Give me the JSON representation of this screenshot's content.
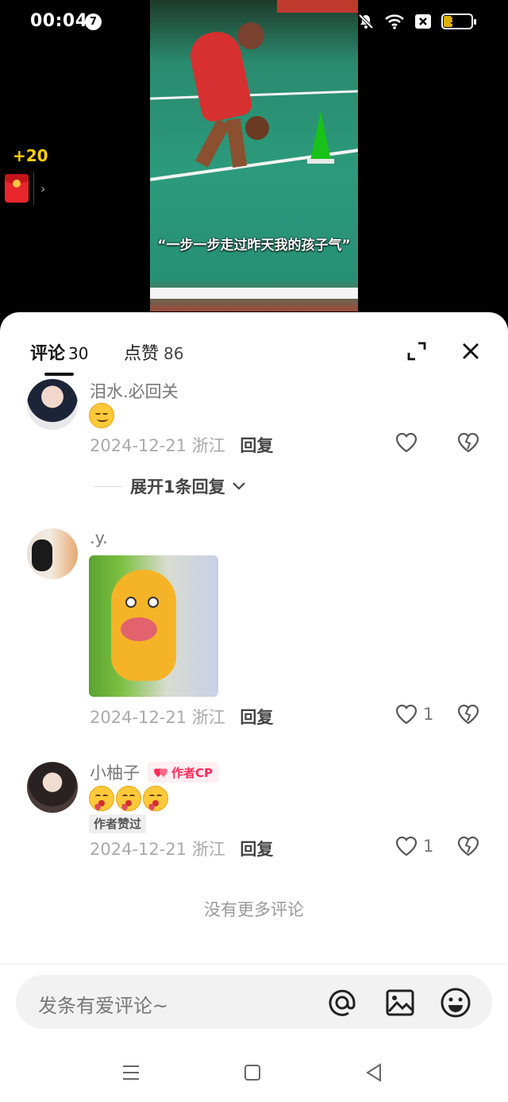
{
  "status_bar": {
    "time": "00:04",
    "notification_count": "7",
    "battery_level": "30"
  },
  "video": {
    "subtitle": "“一步一步走过昨天我的孩子气”",
    "reward_count": "+20",
    "reward_chevron": "›"
  },
  "comments_panel": {
    "tabs": [
      {
        "label": "评论",
        "count": "30"
      },
      {
        "label": "点赞",
        "count": "86"
      }
    ],
    "comments": [
      {
        "author": "泪水.必回关",
        "date": "2024-12-21",
        "location": "浙江",
        "reply_label": "回复",
        "like_count": "",
        "expand_label": "展开1条回复"
      },
      {
        "author": ".y.",
        "date": "2024-12-21",
        "location": "浙江",
        "reply_label": "回复",
        "like_count": "1"
      },
      {
        "author": "小柚子",
        "author_badge": "作者CP",
        "liked_by_author": "作者赞过",
        "date": "2024-12-21",
        "location": "浙江",
        "reply_label": "回复",
        "like_count": "1"
      }
    ],
    "no_more": "没有更多评论",
    "input_placeholder": "发条有爱评论~"
  },
  "colors": {
    "accent_pink": "#ff2c5a",
    "reward_gold": "#ffd200",
    "court_green": "#2c9a7c"
  },
  "icons": [
    "mute-icon",
    "wifi-icon",
    "sim-off-icon",
    "battery-icon",
    "expand-icon",
    "close-icon",
    "heart-icon",
    "broken-heart-icon",
    "chevron-down-icon",
    "at-icon",
    "image-icon",
    "emoji-icon",
    "menu-icon",
    "home-icon",
    "back-icon"
  ]
}
